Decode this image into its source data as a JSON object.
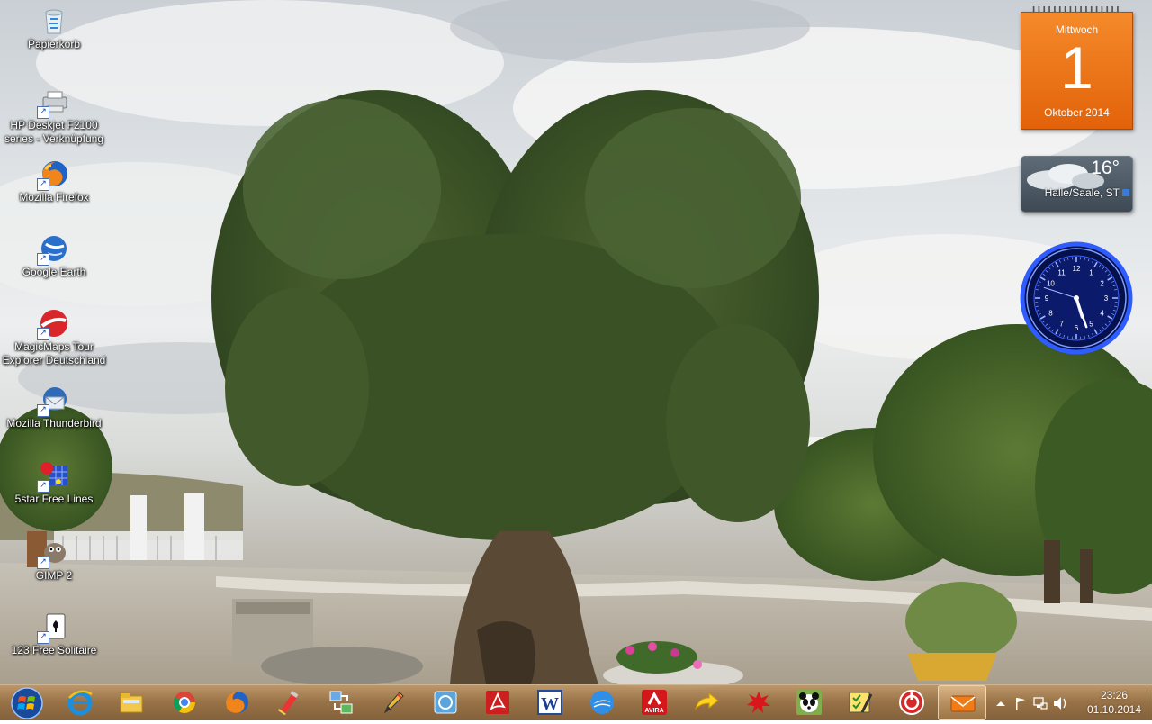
{
  "desktop": {
    "icons": [
      {
        "label_line1": "Papierkorb",
        "label_line2": "",
        "icon": "recycle-bin-icon"
      },
      {
        "label_line1": "HP Deskjet F2100",
        "label_line2": "series - Verknüpfung",
        "icon": "printer-icon"
      },
      {
        "label_line1": "Mozilla Firefox",
        "label_line2": "",
        "icon": "firefox-icon"
      },
      {
        "label_line1": "Google Earth",
        "label_line2": "",
        "icon": "google-earth-icon"
      },
      {
        "label_line1": "MagicMaps Tour",
        "label_line2": "Explorer Deutschland",
        "icon": "magicmaps-icon"
      },
      {
        "label_line1": "Mozilla Thunderbird",
        "label_line2": "",
        "icon": "thunderbird-icon"
      },
      {
        "label_line1": "5star Free Lines",
        "label_line2": "",
        "icon": "lines-game-icon"
      },
      {
        "label_line1": "GIMP 2",
        "label_line2": "",
        "icon": "gimp-icon"
      },
      {
        "label_line1": "123 Free Solitaire",
        "label_line2": "",
        "icon": "solitaire-icon"
      }
    ]
  },
  "gadgets": {
    "calendar": {
      "weekday": "Mittwoch",
      "day": "1",
      "month_year": "Oktober 2014"
    },
    "weather": {
      "temperature": "16°",
      "location": "Halle/Saale, ST"
    },
    "clock": {
      "hour": 5,
      "minute": 26,
      "second": 48,
      "numerals": [
        "12",
        "1",
        "2",
        "3",
        "4",
        "5",
        "6",
        "7",
        "8",
        "9",
        "10",
        "11"
      ]
    }
  },
  "taskbar": {
    "pinned": [
      {
        "name": "internet-explorer-icon",
        "active": false
      },
      {
        "name": "file-explorer-icon",
        "active": false
      },
      {
        "name": "chrome-icon",
        "active": false
      },
      {
        "name": "firefox-icon",
        "active": false
      },
      {
        "name": "ccleaner-icon",
        "active": false
      },
      {
        "name": "network-transfer-icon",
        "active": false
      },
      {
        "name": "pencil-tool-icon",
        "active": false
      },
      {
        "name": "photo-viewer-icon",
        "active": false
      },
      {
        "name": "adobe-reader-icon",
        "active": false
      },
      {
        "name": "word-icon",
        "active": false
      },
      {
        "name": "cloud-sync-icon",
        "active": false
      },
      {
        "name": "avira-icon",
        "active": false
      },
      {
        "name": "yellow-arrow-icon",
        "active": false
      },
      {
        "name": "red-splash-icon",
        "active": false
      },
      {
        "name": "panda-icon",
        "active": false
      },
      {
        "name": "checklist-tool-icon",
        "active": false
      },
      {
        "name": "shield-badge-icon",
        "active": false
      },
      {
        "name": "mail-envelope-icon",
        "active": true
      }
    ],
    "avira_label": "AVIRA",
    "word_letter": "W",
    "clock": {
      "time": "23:26",
      "date": "01.10.2014"
    }
  },
  "colors": {
    "calendar_orange": "#ef7418",
    "taskbar_tan": "#a57845",
    "clock_blue": "#1f3cff"
  }
}
